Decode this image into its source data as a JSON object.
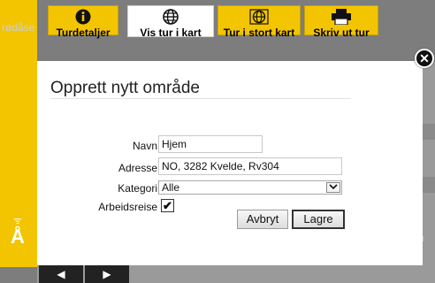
{
  "background": {
    "left_text": "rødåse",
    "right_text": "m",
    "nav_prev": "◀",
    "nav_next": "▶"
  },
  "tabs": [
    {
      "label": "Turdetaljer",
      "icon": "info-icon"
    },
    {
      "label": "Vis tur i kart",
      "icon": "globe-icon"
    },
    {
      "label": "Tur i stort kart",
      "icon": "globe-expand-icon"
    },
    {
      "label": "Skriv ut tur",
      "icon": "printer-icon"
    }
  ],
  "modal": {
    "title": "Opprett nytt område",
    "close_glyph": "✕",
    "fields": {
      "navn": {
        "label": "Navn",
        "value": "Hjem"
      },
      "adresse": {
        "label": "Adresse",
        "value": "NO, 3282 Kvelde, Rv304"
      },
      "kategori": {
        "label": "Kategori",
        "value": "Alle"
      },
      "arbeidsreise": {
        "label": "Arbeidsreise",
        "checked": true,
        "glyph": "✔"
      }
    },
    "buttons": {
      "cancel": "Avbryt",
      "save": "Lagre"
    }
  },
  "colors": {
    "brand_yellow": "#f2c500",
    "overlay_grey": "#8e8e8e"
  }
}
